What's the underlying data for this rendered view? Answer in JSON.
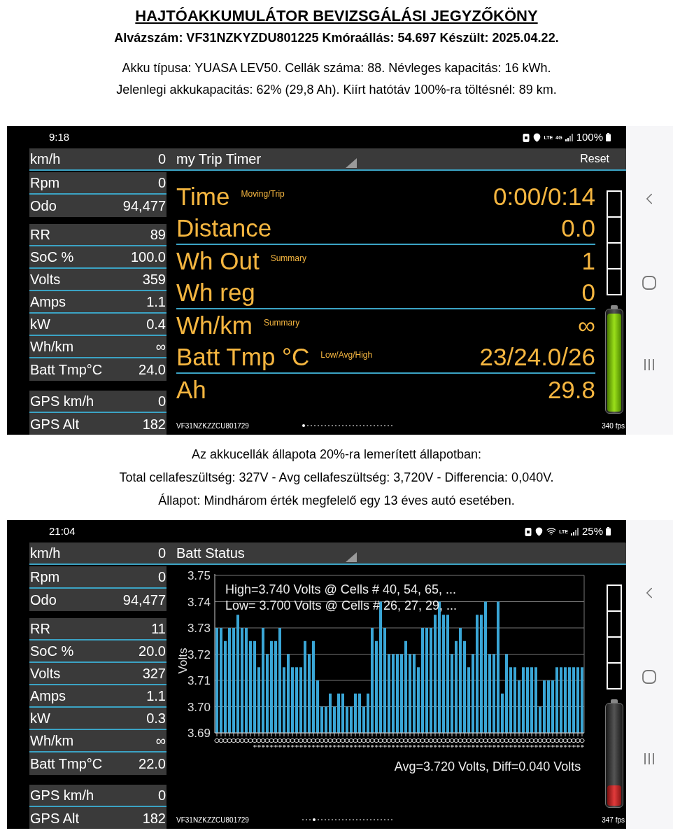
{
  "sections": [
    {
      "kind": "heading",
      "title": "HAJTÓAKKUMULÁTOR BEVIZSGÁLÁSI JEGYZŐKÖNY",
      "subtitle": "Alvázszám: VF31NZKYZDU801225 Kmóraállás: 54.697 Készült: 2025.04.22.",
      "lines": [
        "Akku típusa: YUASA LEV50. Cellák száma: 88. Névleges kapacitás: 16 kWh.",
        "Jelenlegi akkukapacitás: 62% (29,8 Ah). Kiírt hatótáv 100%-ra töltésnél: 89 km."
      ]
    },
    {
      "kind": "screen",
      "status_bar": {
        "time": "9:18",
        "wifi": false,
        "indicators": [
          "LTE",
          "4G"
        ],
        "battery": "100%"
      },
      "gauge_groups": [
        [
          {
            "label": "Rpm",
            "value": "0"
          },
          {
            "label": "Odo",
            "value": "94,477"
          }
        ],
        [
          {
            "label": "RR",
            "value": "89"
          },
          {
            "label": "SoC %",
            "value": "100.0"
          },
          {
            "label": "Volts",
            "value": "359"
          },
          {
            "label": "Amps",
            "value": "1.1"
          },
          {
            "label": "kW",
            "value": "0.4"
          },
          {
            "label": "Wh/km",
            "value": "∞"
          },
          {
            "label": "Batt Tmp°C",
            "value": "24.0"
          }
        ],
        [
          {
            "label": "GPS km/h",
            "value": "0"
          },
          {
            "label": "GPS Alt",
            "value": "182"
          }
        ]
      ],
      "top_gauge": {
        "label": "km/h",
        "value": "0"
      },
      "panel": {
        "title": "my Trip Timer",
        "action": "Reset"
      },
      "view": {
        "kind": "trip",
        "rows": [
          {
            "label": "Time",
            "note": "Moving/Trip",
            "value": "0:00/0:14",
            "rule_below": false
          },
          {
            "label": "Distance",
            "value": "0.0",
            "rule_below": true
          },
          {
            "label": "Wh Out",
            "note": "Summary",
            "value": "1",
            "rule_below": false
          },
          {
            "label": "Wh reg",
            "value": "0",
            "rule_below": true
          },
          {
            "label": "Wh/km",
            "note": "Summary",
            "value": "∞",
            "rule_below": false
          },
          {
            "label": "Batt Tmp °C",
            "note": "Low/Avg/High",
            "value": "23/24.0/26",
            "rule_below": true
          },
          {
            "label": "Ah",
            "value": "29.8",
            "rule_below": false
          }
        ]
      },
      "battery_gauge": {
        "level": 0.97
      },
      "vin": "VF31NZKZZCU801729",
      "fps": "340 fps",
      "page_dots": [
        {
          "selected": true
        },
        {
          "selected": false
        },
        {
          "selected": false
        },
        {
          "selected": false
        },
        {
          "selected": false
        },
        {
          "selected": false
        },
        {
          "selected": false
        },
        {
          "selected": false
        },
        {
          "selected": false
        },
        {
          "selected": false
        },
        {
          "selected": false
        },
        {
          "selected": false
        },
        {
          "selected": false
        },
        {
          "selected": false
        },
        {
          "selected": false
        },
        {
          "selected": false
        },
        {
          "selected": false
        },
        {
          "selected": false
        },
        {
          "selected": false
        },
        {
          "selected": false
        },
        {
          "selected": false
        },
        {
          "selected": false
        },
        {
          "selected": false
        },
        {
          "selected": false
        },
        {
          "selected": false
        },
        {
          "selected": false
        }
      ]
    },
    {
      "kind": "text",
      "lines": [
        "Az akkucellák állapota 20%-ra lemerített állapotban:",
        "Total cellafeszültség: 327V -  Avg cellafeszültség: 3,720V - Differencia: 0,040V.",
        "Állapot: Mindhárom érték megfelelő egy 13 éves autó esetében."
      ]
    },
    {
      "kind": "screen",
      "status_bar": {
        "time": "21:04",
        "wifi": true,
        "indicators": [
          "LTE"
        ],
        "battery": "25%"
      },
      "gauge_groups": [
        [
          {
            "label": "Rpm",
            "value": "0"
          },
          {
            "label": "Odo",
            "value": "94,477"
          }
        ],
        [
          {
            "label": "RR",
            "value": "11"
          },
          {
            "label": "SoC %",
            "value": "20.0"
          },
          {
            "label": "Volts",
            "value": "327"
          },
          {
            "label": "Amps",
            "value": "1.1"
          },
          {
            "label": "kW",
            "value": "0.3"
          },
          {
            "label": "Wh/km",
            "value": "∞"
          },
          {
            "label": "Batt Tmp°C",
            "value": "22.0"
          }
        ],
        [
          {
            "label": "GPS km/h",
            "value": "0"
          },
          {
            "label": "GPS Alt",
            "value": "182"
          }
        ]
      ],
      "top_gauge": {
        "label": "km/h",
        "value": "0"
      },
      "panel": {
        "title": "Batt Status"
      },
      "view": {
        "kind": "chart",
        "chart_data": {
          "type": "bar",
          "grid": true,
          "ylabel": "Volts",
          "ylim": [
            3.69,
            3.75
          ],
          "yticks": [
            {
              "value": 3.69,
              "label": "3.69"
            },
            {
              "value": 3.7,
              "label": "3.70"
            },
            {
              "value": 3.71,
              "label": "3.71"
            },
            {
              "value": 3.72,
              "label": "3.72"
            },
            {
              "value": 3.73,
              "label": "3.73"
            },
            {
              "value": 3.74,
              "label": "3.74"
            },
            {
              "value": 3.75,
              "label": "3.75"
            }
          ],
          "values": [
            3.73,
            3.73,
            3.725,
            3.73,
            3.73,
            3.735,
            3.73,
            3.73,
            3.725,
            3.725,
            3.715,
            3.73,
            3.72,
            3.725,
            3.725,
            3.73,
            3.715,
            3.72,
            3.715,
            3.715,
            3.715,
            3.725,
            3.72,
            3.725,
            3.71,
            3.7,
            3.7,
            3.705,
            3.7,
            3.705,
            3.705,
            3.7,
            3.7,
            3.705,
            3.705,
            3.7,
            3.705,
            3.73,
            3.725,
            3.74,
            3.73,
            3.72,
            3.72,
            3.72,
            3.72,
            3.725,
            3.72,
            3.72,
            3.715,
            3.73,
            3.73,
            3.73,
            3.735,
            3.74,
            3.735,
            3.735,
            3.72,
            3.725,
            3.73,
            3.725,
            3.715,
            3.72,
            3.735,
            3.735,
            3.74,
            3.72,
            3.72,
            3.74,
            3.705,
            3.72,
            3.715,
            3.715,
            3.71,
            3.715,
            3.715,
            3.715,
            3.715,
            3.7,
            3.71,
            3.71,
            3.71,
            3.715,
            3.715,
            3.715,
            3.715,
            3.715,
            3.715,
            3.715
          ],
          "annotations": [
            "High=3.740 Volts @ Cells # 40, 54, 65,  ...",
            "Low= 3.700 Volts @ Cells # 26, 27, 29,  ...",
            "Avg=3.720 Volts, Diff=0.040 Volts"
          ]
        }
      },
      "battery_gauge": {
        "level": 0.2
      },
      "vin": "VF31NZKZZCU801729",
      "fps": "347 fps",
      "page_dots": [
        {
          "selected": false
        },
        {
          "selected": false
        },
        {
          "selected": false
        },
        {
          "selected": true
        },
        {
          "selected": false
        },
        {
          "selected": false
        },
        {
          "selected": false
        },
        {
          "selected": false
        },
        {
          "selected": false
        },
        {
          "selected": false
        },
        {
          "selected": false
        },
        {
          "selected": false
        },
        {
          "selected": false
        },
        {
          "selected": false
        },
        {
          "selected": false
        },
        {
          "selected": false
        },
        {
          "selected": false
        },
        {
          "selected": false
        },
        {
          "selected": false
        },
        {
          "selected": false
        },
        {
          "selected": false
        },
        {
          "selected": false
        },
        {
          "selected": false
        },
        {
          "selected": false
        },
        {
          "selected": false
        },
        {
          "selected": false
        }
      ]
    }
  ]
}
